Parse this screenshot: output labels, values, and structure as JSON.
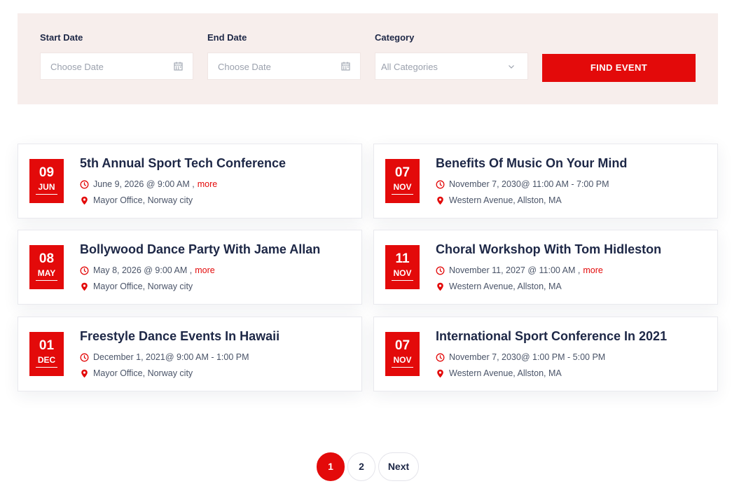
{
  "filters": {
    "start_date": {
      "label": "Start Date",
      "placeholder": "Choose Date"
    },
    "end_date": {
      "label": "End Date",
      "placeholder": "Choose Date"
    },
    "category": {
      "label": "Category",
      "selected": "All Categories"
    },
    "find_button": "FIND EVENT"
  },
  "events": [
    {
      "day": "09",
      "month": "JUN",
      "title": "5th Annual Sport Tech Conference",
      "time": "June 9, 2026 @ 9:00 AM",
      "more": "more",
      "location": "Mayor Office, Norway city"
    },
    {
      "day": "07",
      "month": "NOV",
      "title": "Benefits Of Music On Your Mind",
      "time": "November 7, 2030@ 11:00 AM - 7:00 PM",
      "more": "",
      "location": "Western Avenue, Allston, MA"
    },
    {
      "day": "08",
      "month": "MAY",
      "title": "Bollywood Dance Party With Jame Allan",
      "time": "May 8, 2026 @ 9:00 AM",
      "more": "more",
      "location": "Mayor Office, Norway city"
    },
    {
      "day": "11",
      "month": "NOV",
      "title": "Choral Workshop With Tom Hidleston",
      "time": "November 11, 2027 @ 11:00 AM",
      "more": "more",
      "location": "Western Avenue, Allston, MA"
    },
    {
      "day": "01",
      "month": "DEC",
      "title": "Freestyle Dance Events In Hawaii",
      "time": "December 1, 2021@ 9:00 AM - 1:00 PM",
      "more": "",
      "location": "Mayor Office, Norway city"
    },
    {
      "day": "07",
      "month": "NOV",
      "title": "International Sport Conference In 2021",
      "time": "November 7, 2030@ 1:00 PM - 5:00 PM",
      "more": "",
      "location": "Western Avenue, Allston, MA"
    }
  ],
  "pagination": {
    "pages": [
      "1",
      "2"
    ],
    "current": "1",
    "next_label": "Next"
  },
  "colors": {
    "accent": "#e30a0a",
    "heading": "#1d2746",
    "filter_bg": "#f7eeec"
  },
  "icons": {
    "date_field": "calendar-icon",
    "select": "chevron-down-icon",
    "time": "clock-icon",
    "location": "map-pin-icon"
  }
}
